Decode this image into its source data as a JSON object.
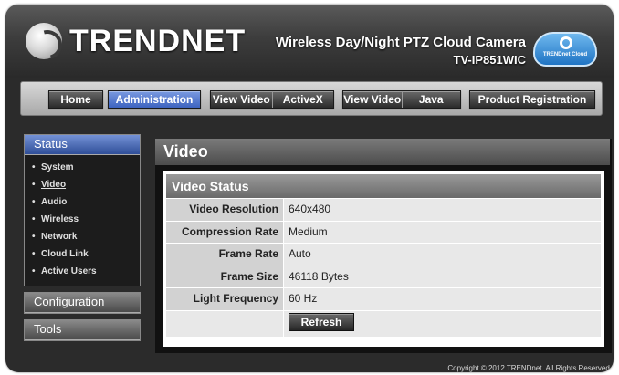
{
  "header": {
    "brand": "TRENDNET",
    "product_title": "Wireless Day/Night PTZ Cloud Camera",
    "product_model": "TV-IP851WIC",
    "cloud_badge": "TRENDnet Cloud"
  },
  "nav": {
    "home": "Home",
    "administration": "Administration",
    "view_video_activex_a": "View Video",
    "view_video_activex_b": "ActiveX",
    "view_video_java_a": "View Video",
    "view_video_java_b": "Java",
    "product_registration": "Product Registration"
  },
  "sidebar": {
    "status": {
      "label": "Status",
      "items": [
        "System",
        "Video",
        "Audio",
        "Wireless",
        "Network",
        "Cloud Link",
        "Active Users"
      ]
    },
    "configuration": {
      "label": "Configuration"
    },
    "tools": {
      "label": "Tools"
    }
  },
  "page": {
    "title": "Video",
    "panel_title": "Video Status",
    "rows": [
      {
        "key": "Video Resolution",
        "value": "640x480"
      },
      {
        "key": "Compression Rate",
        "value": "Medium"
      },
      {
        "key": "Frame Rate",
        "value": "Auto"
      },
      {
        "key": "Frame Size",
        "value": "46118 Bytes"
      },
      {
        "key": "Light Frequency",
        "value": "60 Hz"
      }
    ],
    "refresh_label": "Refresh"
  },
  "footer": {
    "copyright": "Copyright © 2012 TRENDnet.  All Rights Reserved."
  }
}
